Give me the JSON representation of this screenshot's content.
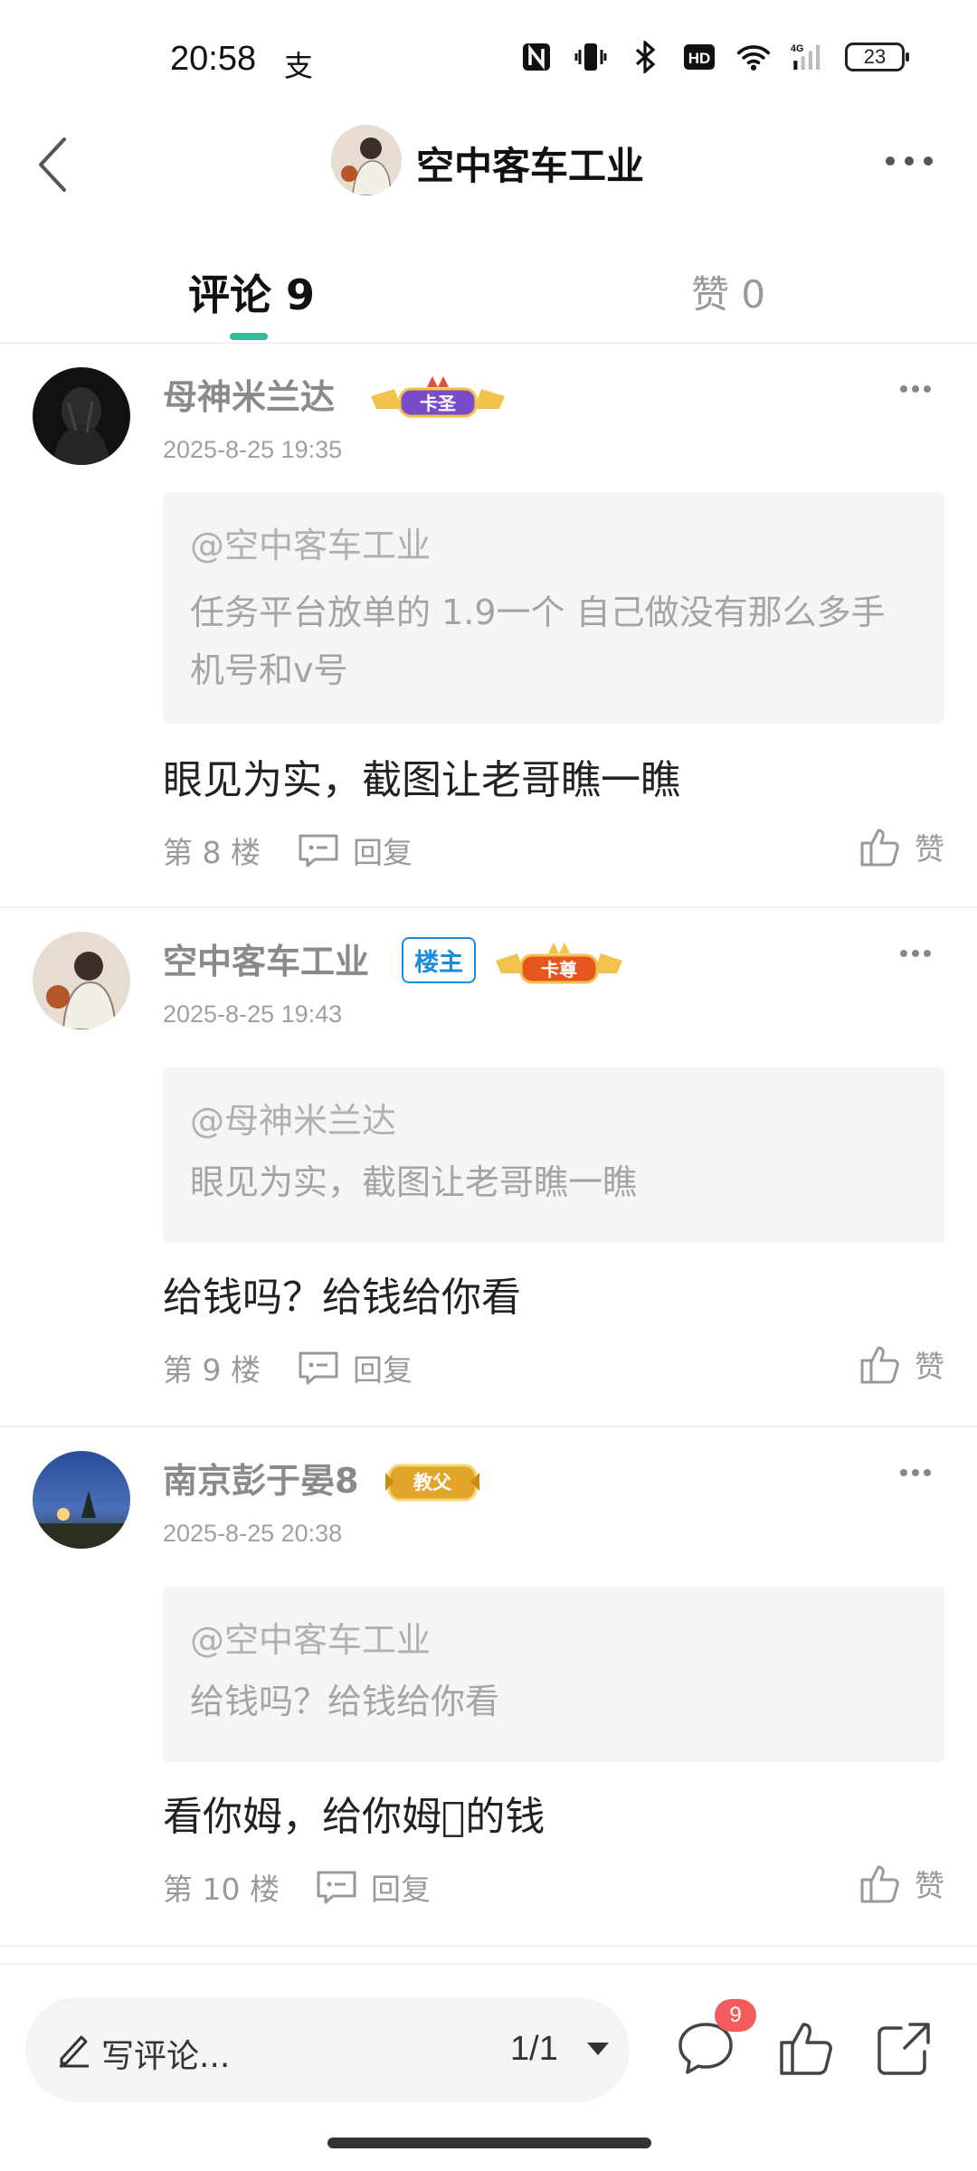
{
  "status_bar": {
    "time": "20:58",
    "alipay_glyph": "支",
    "battery": "23",
    "icons": [
      "nfc-icon",
      "vibrate-icon",
      "bluetooth-icon",
      "hd-icon",
      "wifi-icon",
      "signal-4g-icon"
    ]
  },
  "header": {
    "title": "空中客车工业",
    "back_icon": "chevron-left-icon",
    "more_icon": "more-dots-icon"
  },
  "tabs": {
    "comments": "评论 9",
    "likes": "赞 0",
    "active_color": "#2bbf9a"
  },
  "comments": [
    {
      "name": "母神米兰达",
      "badge": "卡圣",
      "date": "2025-8-25 19:35",
      "quote_at": "@空中客车工业",
      "quote_text": "任务平台放单的 1.9一个 自己做没有那么多手机号和v号",
      "body": "眼见为实，截图让老哥瞧一瞧",
      "floor": "第 8 楼",
      "reply": "回复",
      "like": "赞"
    },
    {
      "name": "空中客车工业",
      "owner_tag": "楼主",
      "badge": "卡尊",
      "date": "2025-8-25 19:43",
      "quote_at": "@母神米兰达",
      "quote_text": "眼见为实，截图让老哥瞧一瞧",
      "body": "给钱吗？给钱给你看",
      "floor": "第 9 楼",
      "reply": "回复",
      "like": "赞"
    },
    {
      "name": "南京彭于晏8",
      "badge": "教父",
      "date": "2025-8-25 20:38",
      "quote_at": "@空中客车工业",
      "quote_text": "给钱吗？给钱给你看",
      "body": "看你姆，给你姆𫠠的钱",
      "floor": "第 10 楼",
      "reply": "回复",
      "like": "赞"
    }
  ],
  "bottom_bar": {
    "write_placeholder": "写评论...",
    "page": "1/1",
    "comment_count": "9",
    "badge_color": "#f25c5c"
  }
}
